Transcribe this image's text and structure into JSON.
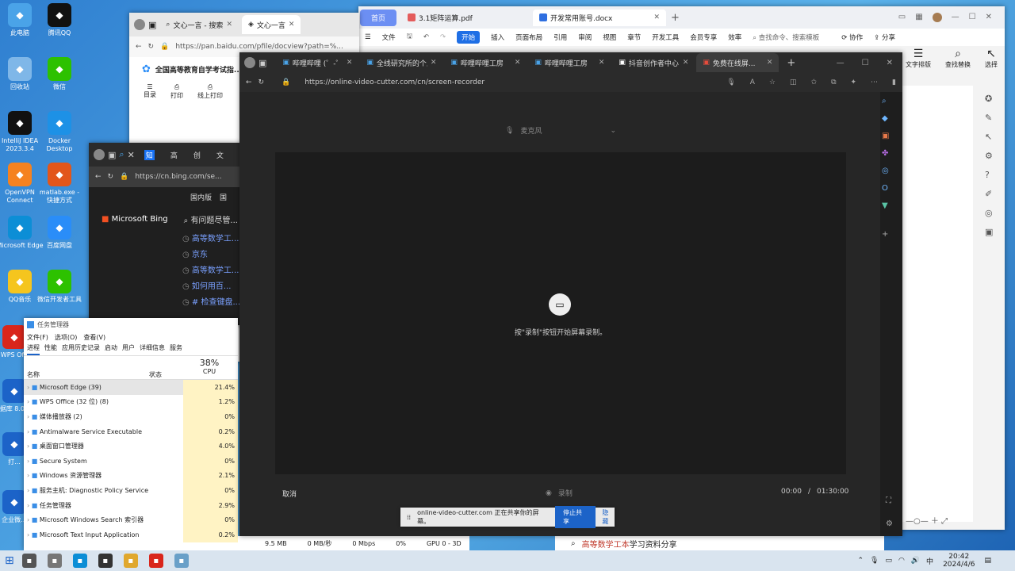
{
  "desktop_icons": [
    {
      "label": "此电脑",
      "icon": "computer-icon",
      "color": "#4aa3e8"
    },
    {
      "label": "腾讯QQ",
      "icon": "qq-icon",
      "color": "#111111"
    },
    {
      "label": "回收站",
      "icon": "recycle-bin-icon",
      "color": "#7fb7e8"
    },
    {
      "label": "微信",
      "icon": "wechat-icon",
      "color": "#2dc100"
    },
    {
      "label": "IntelliJ IDEA 2023.3.4",
      "icon": "intellij-icon",
      "color": "#111111"
    },
    {
      "label": "Docker Desktop",
      "icon": "docker-icon",
      "color": "#1d91e6"
    },
    {
      "label": "OpenVPN Connect",
      "icon": "openvpn-icon",
      "color": "#f58220"
    },
    {
      "label": "matlab.exe - 快捷方式",
      "icon": "matlab-icon",
      "color": "#e2561b"
    },
    {
      "label": "Microsoft Edge",
      "icon": "edge-icon",
      "color": "#0c8ed6"
    },
    {
      "label": "百度网盘",
      "icon": "baidu-netdisk-icon",
      "color": "#2a8df8"
    },
    {
      "label": "QQ音乐",
      "icon": "qq-music-icon",
      "color": "#f5c51e"
    },
    {
      "label": "微信开发者工具",
      "icon": "wechat-devtools-icon",
      "color": "#2dc100"
    },
    {
      "label": "WPS Offi",
      "icon": "wps-icon",
      "color": "#d9261c"
    },
    {
      "label": "数据库 8.0(64",
      "icon": "db-icon",
      "color": "#1c63c8"
    },
    {
      "label": "打...",
      "icon": "app-icon",
      "color": "#1c63c8"
    },
    {
      "label": "企业微...",
      "icon": "wecom-icon",
      "color": "#1c63c8"
    }
  ],
  "baidu_browser": {
    "tabs": [
      "文心一言 - 搜索",
      "文心一言"
    ],
    "url": "https://pan.baidu.com/pfile/docview?path=%...",
    "doc_title": "全国高等教育自学考试指...",
    "tools": [
      "目录",
      "打印",
      "线上打印"
    ]
  },
  "wps": {
    "tabs": [
      "首页",
      "3.1矩阵运算.pdf",
      "开发常用账号.docx"
    ],
    "menu": [
      "文件",
      "开始",
      "插入",
      "页面布局",
      "引用",
      "审阅",
      "视图",
      "章节",
      "开发工具",
      "会员专享",
      "效率"
    ],
    "search_placeholder": "查找命令、搜索模板",
    "collab": "协作",
    "share": "分享",
    "ribbon_right": [
      "文字排版",
      "查找替换",
      "选择"
    ]
  },
  "bing_browser": {
    "tabs": [
      "知",
      "高",
      "创",
      "文"
    ],
    "url": "https://cn.bing.com/se...",
    "region_tabs": [
      "国内版",
      "国"
    ],
    "logo": "Microsoft Bing",
    "search_value": "有问题尽管...",
    "history": [
      "高等数学工...",
      "京东",
      "高等数学工...",
      "如何用百...",
      "# 检查键盘..."
    ]
  },
  "task_manager": {
    "title": "任务管理器",
    "menu": [
      "文件(F)",
      "选项(O)",
      "查看(V)"
    ],
    "tabs": [
      "进程",
      "性能",
      "应用历史记录",
      "启动",
      "用户",
      "详细信息",
      "服务"
    ],
    "cpu_total": "38%",
    "col_name": "名称",
    "col_status": "状态",
    "col_cpu": "CPU",
    "rows": [
      {
        "name": "Microsoft Edge (39)",
        "cpu": "21.4%"
      },
      {
        "name": "WPS Office (32 位) (8)",
        "cpu": "1.2%"
      },
      {
        "name": "媒体播放器 (2)",
        "cpu": "0%"
      },
      {
        "name": "Antimalware Service Executable",
        "cpu": "0.2%"
      },
      {
        "name": "桌面窗口管理器",
        "cpu": "4.0%"
      },
      {
        "name": "Secure System",
        "cpu": "0%"
      },
      {
        "name": "Windows 资源管理器",
        "cpu": "2.1%"
      },
      {
        "name": "服务主机: Diagnostic Policy Service",
        "cpu": "0%"
      },
      {
        "name": "任务管理器",
        "cpu": "2.9%"
      },
      {
        "name": "Microsoft Windows Search 索引器",
        "cpu": "0%"
      },
      {
        "name": "Microsoft Text Input Application",
        "cpu": "0.2%"
      }
    ],
    "last_row_extra": {
      "mem": "9.5 MB",
      "disk": "0 MB/秒",
      "net": "0 Mbps",
      "gpu": "0%",
      "engine": "GPU 0 - 3D"
    }
  },
  "main_browser": {
    "tabs": [
      "哔哩哔哩 (゜-゜)",
      "全线研究所的个人...",
      "哔哩哔哩工房",
      "哔哩哔哩工房",
      "抖音创作者中心",
      "免费在线屏..."
    ],
    "url": "https://online-video-cutter.com/cn/screen-recorder",
    "mic_label": "麦克风",
    "hint": "按\"录制\"按钮开始屏幕录制。",
    "cancel": "取消",
    "record": "录制",
    "time_current": "00:00",
    "time_sep": "/",
    "time_total": "01:30:00",
    "share_bar_text": "online-video-cutter.com 正在共享你的屏幕。",
    "stop_share": "停止共享",
    "hide": "隐藏"
  },
  "search_bar_text": {
    "highlight": "高等数学工本",
    "rest": "学习资料分享"
  },
  "taskbar": {
    "apps": [
      "search-icon",
      "explorer-icon",
      "edge-icon",
      "media-icon",
      "folder-icon",
      "wps-icon",
      "app-icon"
    ],
    "ime": "中",
    "time": "20:42",
    "date": "2024/4/6"
  },
  "colors": {
    "accent": "#1a73e8",
    "wps_accent": "#1f6fe5",
    "stop_share": "#1c63c8"
  }
}
